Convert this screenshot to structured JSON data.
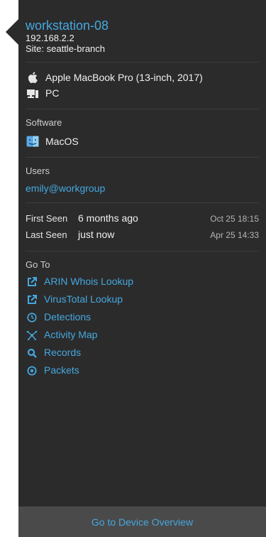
{
  "device": {
    "name": "workstation-08",
    "ip": "192.168.2.2",
    "site": "Site: seattle-branch"
  },
  "hardware": {
    "model": "Apple MacBook Pro (13-inch, 2017)",
    "model_icon": "apple-icon",
    "type": "PC",
    "type_icon": "computer-icon"
  },
  "software": {
    "title": "Software",
    "os": "MacOS",
    "os_icon": "finder-icon"
  },
  "users": {
    "title": "Users",
    "user": "emily@workgroup"
  },
  "seen": {
    "first_label": "First Seen",
    "first_relative": "6 months ago",
    "first_date": "Oct 25 18:15",
    "last_label": "Last Seen",
    "last_relative": "just now",
    "last_date": "Apr 25 14:33"
  },
  "goto": {
    "title": "Go To",
    "items": [
      {
        "label": "ARIN Whois Lookup",
        "icon": "external-link-icon"
      },
      {
        "label": "VirusTotal Lookup",
        "icon": "external-link-icon"
      },
      {
        "label": "Detections",
        "icon": "detections-icon"
      },
      {
        "label": "Activity Map",
        "icon": "activity-map-icon"
      },
      {
        "label": "Records",
        "icon": "search-icon"
      },
      {
        "label": "Packets",
        "icon": "packets-icon"
      }
    ]
  },
  "footer": {
    "button_label": "Go to Device Overview"
  },
  "colors": {
    "panel_bg": "#2b2b2b",
    "accent": "#45a8e0",
    "footer_bg": "#4a4a4a"
  }
}
